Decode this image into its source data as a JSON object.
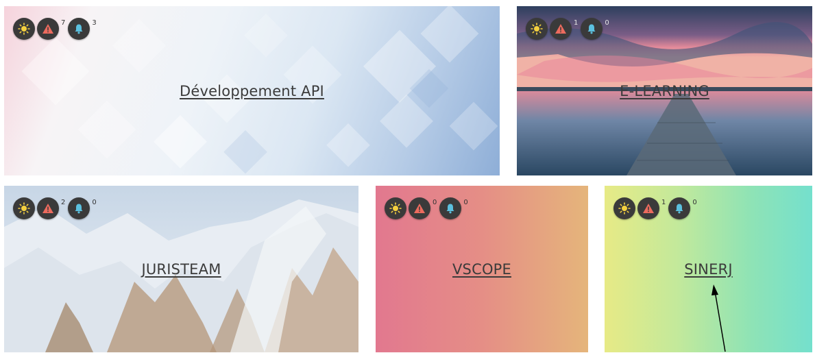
{
  "colors": {
    "badge_bg": "#3a3a3a",
    "sun_icon": "#f4d03f",
    "alert_icon": "#ec6b5e",
    "bell_icon": "#5bc0de"
  },
  "icons": [
    "sun-icon",
    "alert-triangle-icon",
    "bell-icon"
  ],
  "projects": [
    {
      "title": "Développement API",
      "alerts": "7",
      "notifications": "3"
    },
    {
      "title": "E-LEARNING",
      "alerts": "1",
      "notifications": "0"
    },
    {
      "title": "JURISTEAM",
      "alerts": "2",
      "notifications": "0"
    },
    {
      "title": "VSCOPE",
      "alerts": "0",
      "notifications": "0"
    },
    {
      "title": "SINERJ",
      "alerts": "1",
      "notifications": "0"
    }
  ]
}
